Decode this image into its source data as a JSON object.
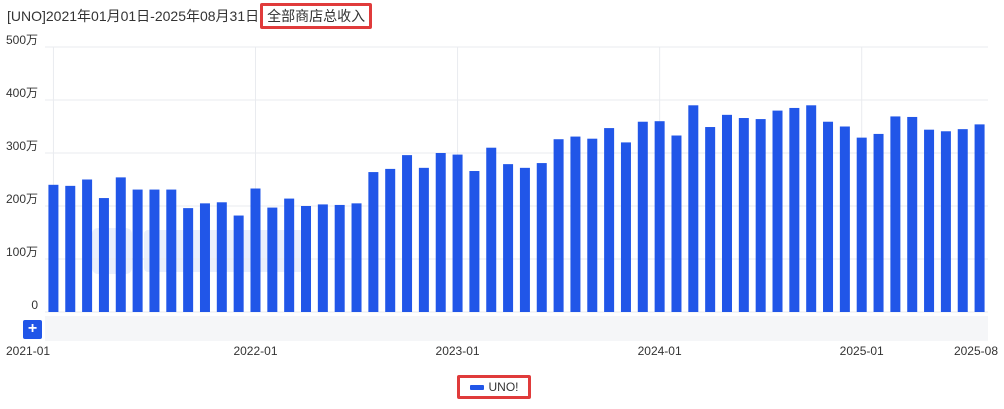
{
  "title": {
    "prefix": "[UNO]2021年01月01日-2025年08月31日",
    "metric": "全部商店总收入"
  },
  "legend": {
    "label": "UNO!"
  },
  "zoom_button": {
    "label": "+"
  },
  "colors": {
    "bar": "#2156e8",
    "highlight": "#e03b3b",
    "grid": "#e9ebef"
  },
  "chart_data": {
    "type": "bar",
    "title": "全部商店总收入",
    "series": [
      {
        "name": "UNO!",
        "values": [
          240,
          238,
          250,
          215,
          254,
          231,
          231,
          231,
          196,
          205,
          207,
          182,
          233,
          197,
          214,
          200,
          203,
          202,
          205,
          264,
          270,
          296,
          272,
          300,
          297,
          266,
          310,
          279,
          272,
          281,
          326,
          331,
          327,
          347,
          320,
          359,
          360,
          333,
          390,
          349,
          372,
          366,
          364,
          380,
          385,
          390,
          359,
          350,
          329,
          336,
          369,
          368,
          344,
          341,
          345,
          354
        ]
      }
    ],
    "ylim": [
      0,
      500
    ],
    "y_ticks": [
      0,
      100,
      200,
      300,
      400,
      500
    ],
    "y_tick_labels": [
      "0",
      "100万",
      "200万",
      "300万",
      "400万",
      "500万"
    ],
    "x_tick_labels": [
      {
        "index": 0,
        "label": "2021-01"
      },
      {
        "index": 12,
        "label": "2022-01"
      },
      {
        "index": 24,
        "label": "2023-01"
      },
      {
        "index": 36,
        "label": "2024-01"
      },
      {
        "index": 48,
        "label": "2025-01"
      },
      {
        "index": 55,
        "label": "2025-08"
      }
    ],
    "grid": true
  }
}
